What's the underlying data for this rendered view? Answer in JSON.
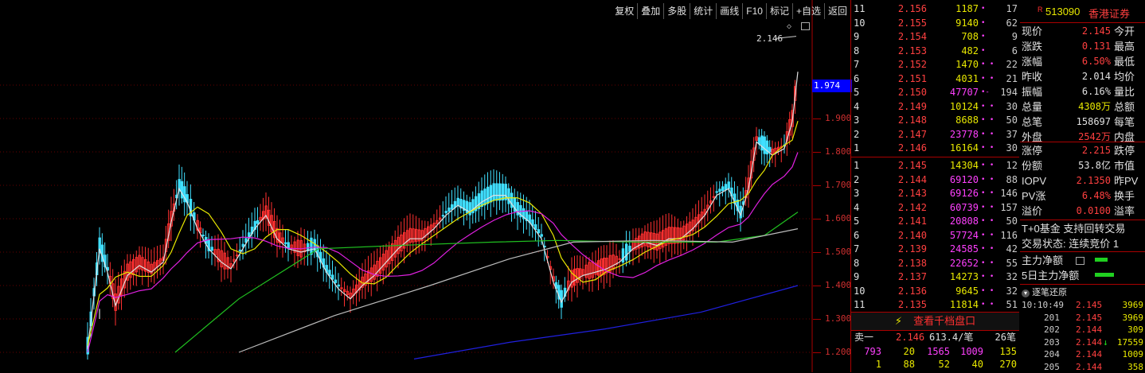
{
  "toolbar": [
    "复权",
    "叠加",
    "多股",
    "统计",
    "画线",
    "F10",
    "标记",
    "+自选",
    "返回"
  ],
  "chart": {
    "price_high_label": "2.146",
    "current_price_tag": "1.974",
    "yaxis_ticks": [
      "1.900",
      "1.800",
      "1.700",
      "1.600",
      "1.500",
      "1.400",
      "1.300",
      "1.200"
    ],
    "candle_up_color": "#ff3030",
    "candle_down_color": "#40e0ff"
  },
  "ask_levels": [
    {
      "level": "11",
      "price": "2.156",
      "vol": "1187",
      "dots": "•",
      "cnt": "17"
    },
    {
      "level": "10",
      "price": "2.155",
      "vol": "9140",
      "dots": "•",
      "cnt": "62"
    },
    {
      "level": "9",
      "price": "2.154",
      "vol": "708",
      "dots": "•",
      "cnt": "9"
    },
    {
      "level": "8",
      "price": "2.153",
      "vol": "482",
      "dots": "•",
      "cnt": "6"
    },
    {
      "level": "7",
      "price": "2.152",
      "vol": "1470",
      "dots": "• •",
      "cnt": "22"
    },
    {
      "level": "6",
      "price": "2.151",
      "vol": "4031",
      "dots": "• •",
      "cnt": "21"
    },
    {
      "level": "5",
      "price": "2.150",
      "vol": "47707",
      "dots": "•-",
      "cnt": "194"
    },
    {
      "level": "4",
      "price": "2.149",
      "vol": "10124",
      "dots": "• •",
      "cnt": "30"
    },
    {
      "level": "3",
      "price": "2.148",
      "vol": "8688",
      "dots": "• •",
      "cnt": "50"
    },
    {
      "level": "2",
      "price": "2.147",
      "vol": "23778",
      "dots": "• •",
      "cnt": "37"
    },
    {
      "level": "1",
      "price": "2.146",
      "vol": "16164",
      "dots": "• •",
      "cnt": "30"
    }
  ],
  "bid_levels": [
    {
      "level": "1",
      "price": "2.145",
      "vol": "14304",
      "dots": "• •",
      "cnt": "12"
    },
    {
      "level": "2",
      "price": "2.144",
      "vol": "69120",
      "dots": "• •",
      "cnt": "88"
    },
    {
      "level": "3",
      "price": "2.143",
      "vol": "69126",
      "dots": "• •",
      "cnt": "146"
    },
    {
      "level": "4",
      "price": "2.142",
      "vol": "60739",
      "dots": "• •",
      "cnt": "157"
    },
    {
      "level": "5",
      "price": "2.141",
      "vol": "20808",
      "dots": "• •",
      "cnt": "50"
    },
    {
      "level": "6",
      "price": "2.140",
      "vol": "57724",
      "dots": "• •",
      "cnt": "116"
    },
    {
      "level": "7",
      "price": "2.139",
      "vol": "24585",
      "dots": "• •",
      "cnt": "42"
    },
    {
      "level": "8",
      "price": "2.138",
      "vol": "22652",
      "dots": "• •",
      "cnt": "55"
    },
    {
      "level": "9",
      "price": "2.137",
      "vol": "14273",
      "dots": "• •",
      "cnt": "32"
    },
    {
      "level": "10",
      "price": "2.136",
      "vol": "9645",
      "dots": "• •",
      "cnt": "32"
    },
    {
      "level": "11",
      "price": "2.135",
      "vol": "11814",
      "dots": "• •",
      "cnt": "51"
    }
  ],
  "qian_button": "查看千档盘口",
  "tick_summary": {
    "label": "卖一",
    "price": "2.146",
    "avg": "613.4/笔",
    "count": "26笔"
  },
  "tick_rows": [
    [
      "793",
      "20",
      "1565",
      "1009",
      "135"
    ],
    [
      "1",
      "88",
      "52",
      "40",
      "270"
    ]
  ],
  "info": {
    "code": "513090",
    "name": "香港证券",
    "rows": [
      {
        "k": "现价",
        "v": "2.145",
        "c": "red",
        "k2": "今开"
      },
      {
        "k": "涨跌",
        "v": "0.131",
        "c": "red",
        "k2": "最高"
      },
      {
        "k": "涨幅",
        "v": "6.50%",
        "c": "red",
        "k2": "最低"
      },
      {
        "k": "昨收",
        "v": "2.014",
        "c": "wh",
        "k2": "均价"
      },
      {
        "k": "振幅",
        "v": "6.16%",
        "c": "wh",
        "k2": "量比"
      },
      {
        "k": "总量",
        "v": "4308万",
        "c": "yl",
        "k2": "总额"
      },
      {
        "k": "总笔",
        "v": "158697",
        "c": "wh",
        "k2": "每笔"
      },
      {
        "k": "外盘",
        "v": "2542万",
        "c": "red",
        "k2": "内盘"
      }
    ],
    "rows2": [
      {
        "k": "涨停",
        "v": "2.215",
        "c": "red",
        "k2": "跌停"
      },
      {
        "k": "份额",
        "v": "53.8亿",
        "c": "wh",
        "k2": "市值"
      },
      {
        "k": "IOPV",
        "v": "2.1350",
        "c": "red",
        "k2": "昨PV"
      },
      {
        "k": "PV涨",
        "v": "6.48%",
        "c": "red",
        "k2": "换手"
      },
      {
        "k": "溢价",
        "v": "0.0100",
        "c": "red",
        "k2": "溢率"
      }
    ],
    "t0_text": "T+0基金 支持回转交易",
    "trade_status": "交易状态: 连续竞价 1",
    "main_net": "主力净额",
    "main_net5": "5日主力净额",
    "detail_title": "逐笔还原"
  },
  "trades": [
    {
      "id": "10:10:49",
      "price": "2.145",
      "vol": "3969",
      "arrow": ""
    },
    {
      "id": "201",
      "price": "2.145",
      "vol": "3969",
      "arrow": ""
    },
    {
      "id": "202",
      "price": "2.144",
      "vol": "309",
      "arrow": ""
    },
    {
      "id": "203",
      "price": "2.144",
      "vol": "17559",
      "arrow": "↓"
    },
    {
      "id": "204",
      "price": "2.144",
      "vol": "1009",
      "arrow": ""
    },
    {
      "id": "205",
      "price": "2.144",
      "vol": "358",
      "arrow": ""
    }
  ]
}
